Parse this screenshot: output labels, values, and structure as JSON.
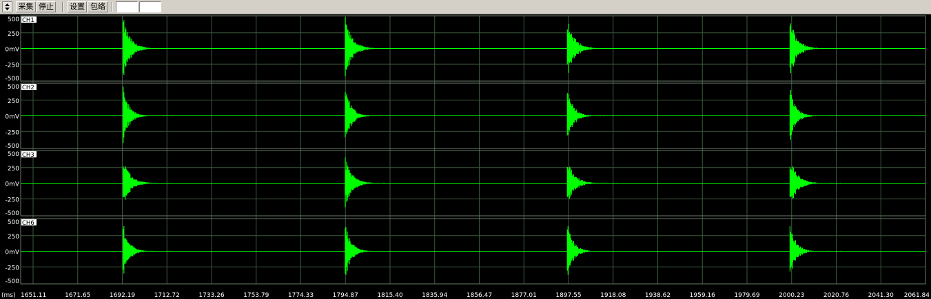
{
  "toolbar": {
    "spinner_icon": "up-down-spinner-icon",
    "acquire_label": "采集",
    "stop_label": "停止",
    "settings_label": "设置",
    "envelope_label": "包络",
    "input1_value": "",
    "input2_value": ""
  },
  "scope": {
    "background": "#000000",
    "grid_color": "#3c5a3c",
    "trace_color": "#00ff00",
    "x_unit": "(ms)",
    "x_ticks": [
      "1651.11",
      "1671.65",
      "1692.19",
      "1712.72",
      "1733.26",
      "1753.79",
      "1774.33",
      "1794.87",
      "1815.40",
      "1835.94",
      "1856.47",
      "1877.01",
      "1897.55",
      "1918.08",
      "1938.62",
      "1959.16",
      "1979.69",
      "2000.23",
      "2020.76",
      "2041.30",
      "2061.84"
    ],
    "y_ticks": [
      "500",
      "250",
      "0mV",
      "-250",
      "-500"
    ],
    "event_times_ms": [
      1692.6,
      1794.8,
      1897.0,
      1999.5
    ],
    "channels": [
      {
        "name": "CH1",
        "amplitude": 500,
        "decay_ms": 6
      },
      {
        "name": "CH2",
        "amplitude": 480,
        "decay_ms": 5
      },
      {
        "name": "CH3",
        "amplitude": 420,
        "decay_ms": 6
      },
      {
        "name": "CH6",
        "amplitude": 470,
        "decay_ms": 5
      }
    ]
  }
}
